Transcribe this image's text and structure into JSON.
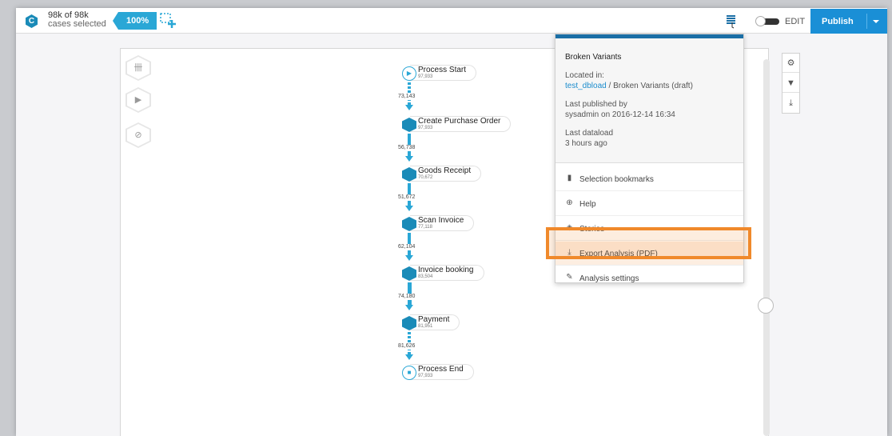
{
  "topbar": {
    "cases_line1": "98k of 98k",
    "cases_line2": "cases selected",
    "percent": "100%",
    "edit": "EDIT",
    "publish": "Publish",
    "logo_letter": "C"
  },
  "process": {
    "nodes": [
      {
        "name": "Process Start",
        "count": "97,933"
      },
      {
        "name": "Create Purchase Order",
        "count": "97,933"
      },
      {
        "name": "Goods Receipt",
        "count": "70,672"
      },
      {
        "name": "Scan Invoice",
        "count": "77,118"
      },
      {
        "name": "Invoice booking",
        "count": "83,504"
      },
      {
        "name": "Payment",
        "count": "81,951"
      },
      {
        "name": "Process End",
        "count": "97,933"
      }
    ],
    "edges": [
      "73,143",
      "56,738",
      "51,672",
      "62,104",
      "74,180",
      "81,626"
    ]
  },
  "dropdown": {
    "title": "Broken Variants",
    "located_label": "Located in:",
    "location_link": "test_dbload",
    "location_sep": " / ",
    "location_rest": "Broken Variants (draft)",
    "published_label": "Last published by",
    "published_value": "sysadmin on 2016-12-14 16:34",
    "dataload_label": "Last dataload",
    "dataload_value": "3 hours ago",
    "items": [
      {
        "label": "Selection bookmarks",
        "icon": "bookmark-icon"
      },
      {
        "label": "Help",
        "icon": "help-icon"
      },
      {
        "label": "Stories",
        "icon": "stories-icon"
      },
      {
        "label": "Export Analysis (PDF)",
        "icon": "download-icon"
      },
      {
        "label": "Analysis settings",
        "icon": "wrench-icon"
      }
    ]
  },
  "colors": {
    "accent": "#2aa7d6",
    "node": "#1a8bb8",
    "publish": "#1a8fd6",
    "highlight": "#f0892b"
  }
}
